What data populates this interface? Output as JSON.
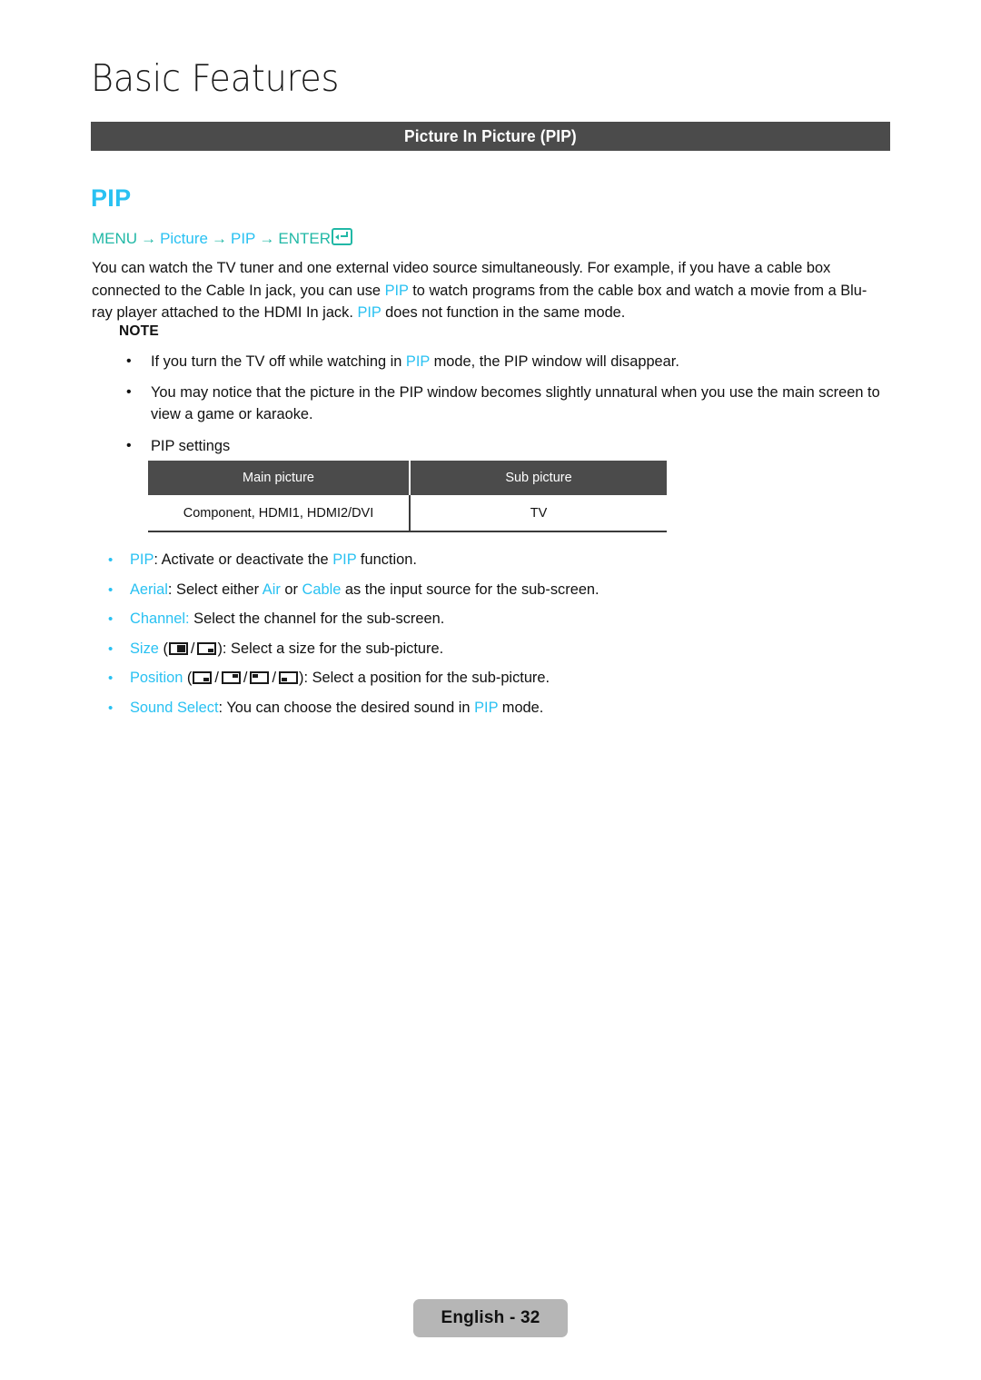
{
  "page": {
    "chapter_title": "Basic Features",
    "section_banner": "Picture In Picture (PIP)",
    "footer_label": "English - 32"
  },
  "feature": {
    "heading": "PIP",
    "menu_path": {
      "menu_label": "MENU",
      "arrow": "→",
      "picture_label": "Picture",
      "pip_label": "PIP",
      "enter_label": "ENTER",
      "enter_icon": "enter-return-icon"
    },
    "intro_paragraph": {
      "part1": "You can watch the TV tuner and one external video source simultaneously. For example, if you have a cable box connected to the Cable In jack, you can use ",
      "hl1": "PIP",
      "part2": " to watch programs from the cable box and watch a movie from a Blu-ray player attached to the HDMI In jack. ",
      "hl2": "PIP",
      "part3": " does not function in the same mode."
    }
  },
  "note": {
    "title": "NOTE",
    "bullet_char": "•",
    "items": [
      {
        "part1": "If you turn the TV off while watching in ",
        "hl1": "PIP",
        "part2": " mode, the PIP window will disappear."
      },
      {
        "part1": "You may notice that the picture in the PIP window becomes slightly unnatural when you use the main screen to view a game or karaoke.",
        "hl1": "",
        "part2": ""
      },
      {
        "part1": "PIP settings",
        "hl1": "",
        "part2": ""
      }
    ]
  },
  "pip_table": {
    "headers": [
      "Main picture",
      "Sub picture"
    ],
    "rows": [
      [
        "Component, HDMI1, HDMI2/DVI",
        "TV"
      ]
    ]
  },
  "settings": {
    "bullet_char": "•",
    "pip": {
      "label": "PIP",
      "sep": ": Activate or deactivate the ",
      "hl": "PIP",
      "tail": " function."
    },
    "aerial": {
      "label": "Aerial",
      "sep": ": Select either ",
      "hl1": "Air",
      "mid": " or ",
      "hl2": "Cable",
      "tail": " as the input source for the sub-screen."
    },
    "channel": {
      "label": "Channel:",
      "tail": " Select the channel for the sub-screen."
    },
    "size": {
      "label": "Size",
      "open": " (",
      "slash": "/",
      "close": "): Select a size for the sub-picture.",
      "icons": [
        "pip-size-large-icon",
        "pip-size-small-icon"
      ]
    },
    "position": {
      "label": "Position",
      "open": " (",
      "slash": "/",
      "close": "): Select a position for the sub-picture.",
      "icons": [
        "pip-pos-bottom-right-icon",
        "pip-pos-top-right-icon",
        "pip-pos-top-left-icon",
        "pip-pos-bottom-left-icon"
      ]
    },
    "sound_select": {
      "label": "Sound Select",
      "sep": ": You can choose the desired sound in ",
      "hl": "PIP",
      "tail": " mode."
    }
  },
  "colors": {
    "accent_blue": "#29c1f2",
    "accent_teal": "#21b8a6",
    "banner_gray": "#4b4b4b",
    "footer_gray": "#b6b6b6"
  }
}
